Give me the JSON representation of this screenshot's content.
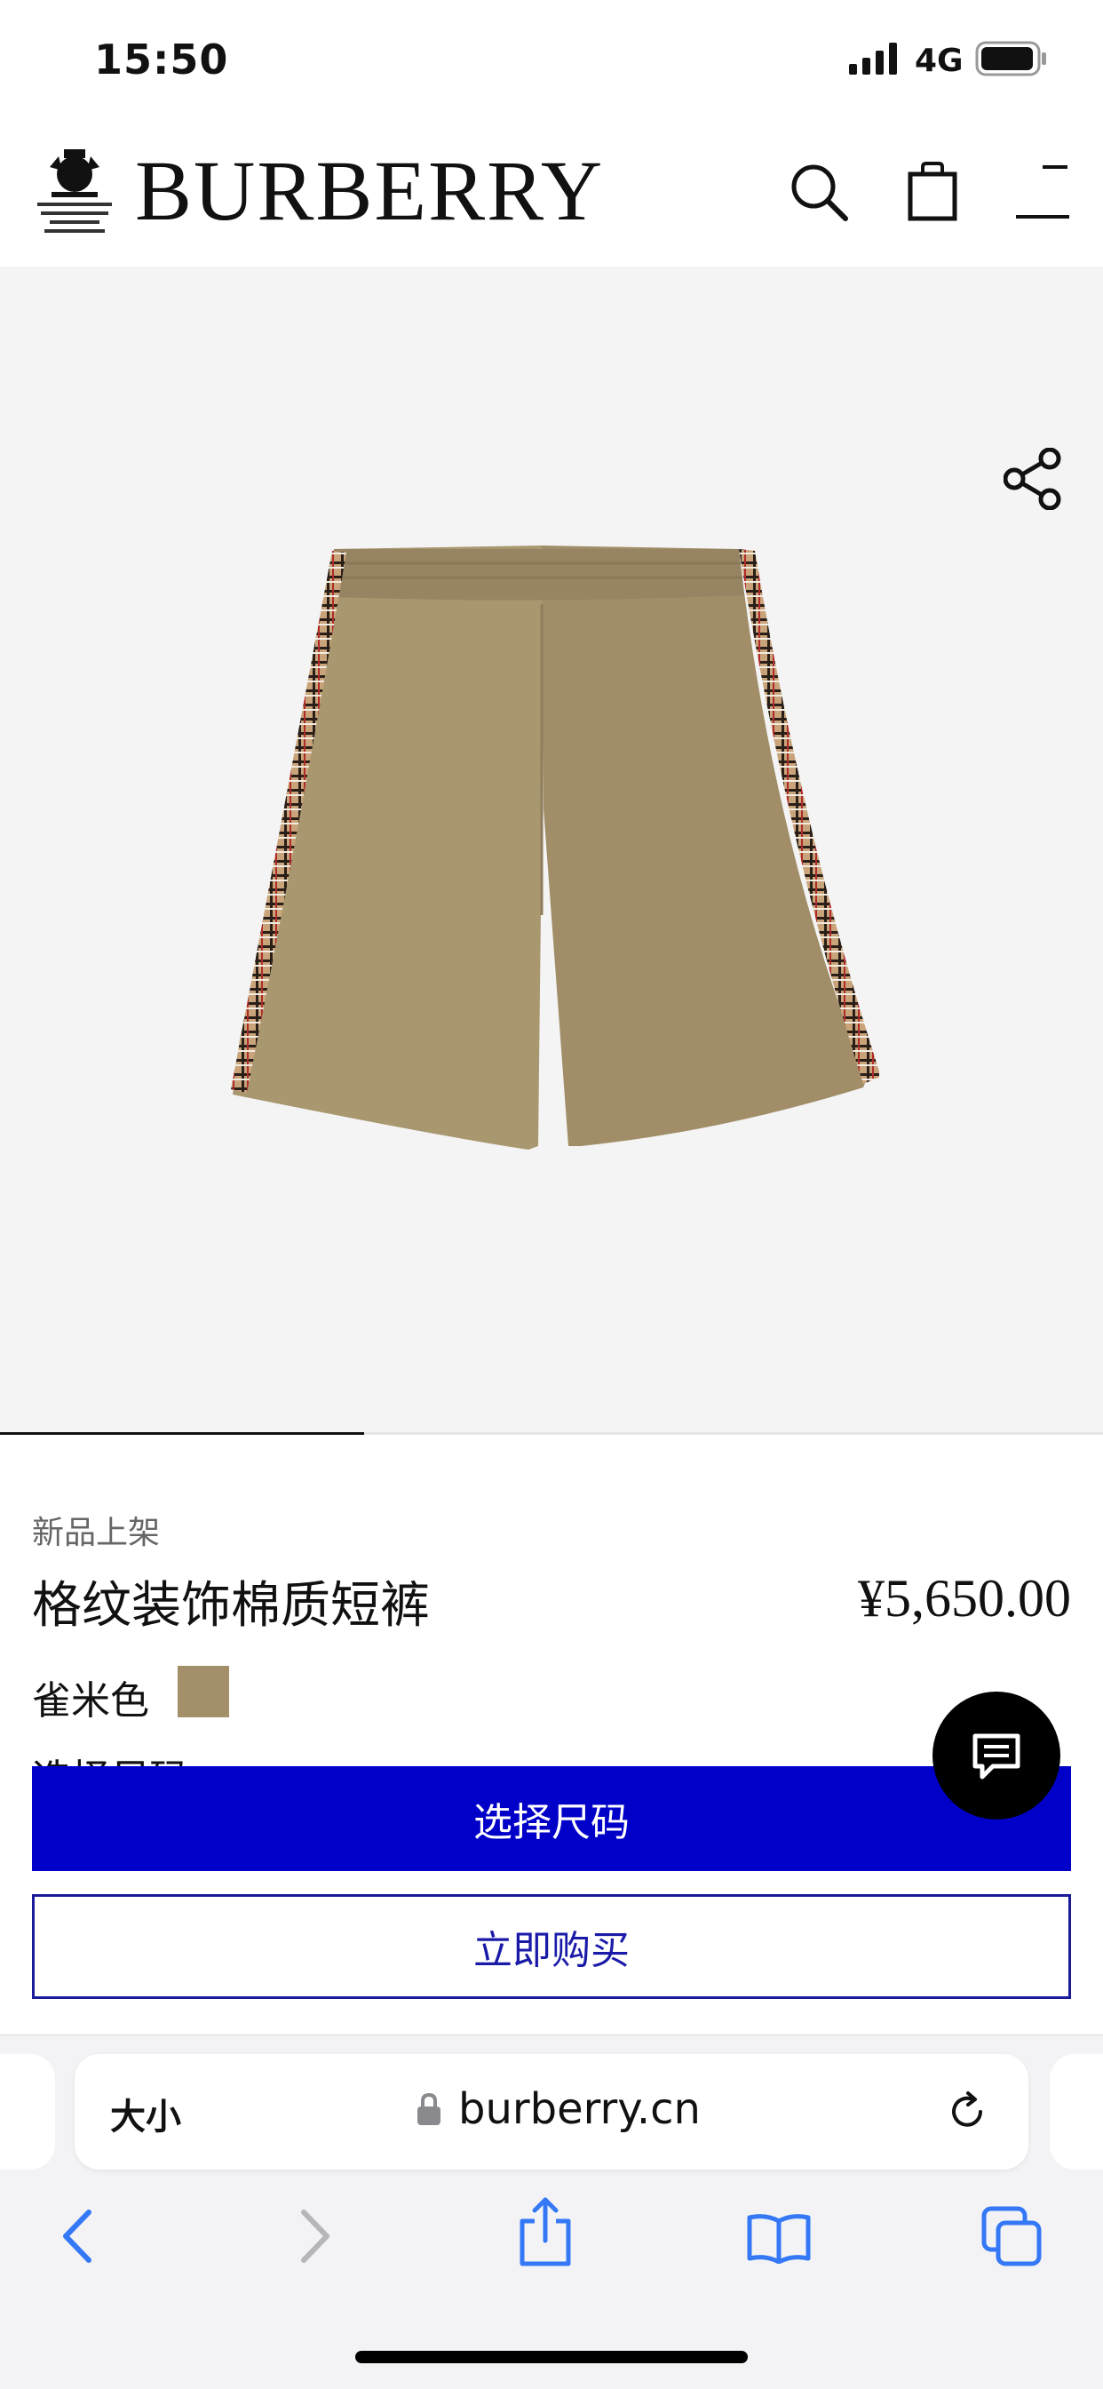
{
  "status_bar": {
    "time": "15:50",
    "network": "4G",
    "battery_level": 0.85
  },
  "header": {
    "brand": "BURBERRY",
    "crest_text": [
      "BY APPOINTMENT TO",
      "HIS MAJESTY KING CHARLES III",
      "OUTFITTERS",
      "BURBERRY LIMITED LONDON"
    ],
    "icons": [
      "search-icon",
      "shopping-bag-icon",
      "menu-icon"
    ]
  },
  "gallery": {
    "progress": 0.33,
    "share_icon": "share-icon"
  },
  "product": {
    "tag": "新品上架",
    "title": "格纹装饰棉质短裤",
    "price": "¥5,650.00",
    "color_name": "雀米色",
    "color_hex": "#a48f6b",
    "size_prompt": "选择尺码"
  },
  "actions": {
    "select_size": "选择尺码",
    "buy_now": "立即购买"
  },
  "browser": {
    "text_size_label": "大小",
    "url": "burberry.cn",
    "icons": [
      "lock-icon",
      "reload-icon",
      "back-icon",
      "forward-icon",
      "share-icon",
      "bookmarks-icon",
      "tabs-icon"
    ]
  },
  "colors": {
    "accent_blue": "#0000c8",
    "blue_outline": "#1a1a9a",
    "safari_blue": "#3478f6"
  }
}
